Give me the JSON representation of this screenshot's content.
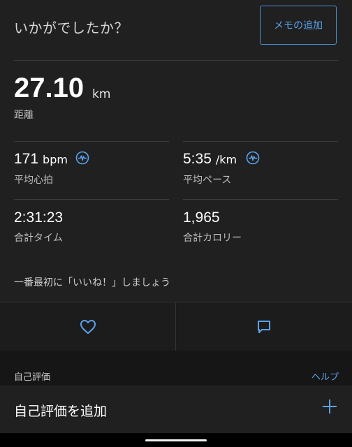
{
  "header": {
    "prompt": "いかがでしたか？",
    "memo_button": "メモの追加"
  },
  "distance": {
    "value": "27.10",
    "unit": "km",
    "label": "距離"
  },
  "stats": [
    {
      "value": "171",
      "unit": "bpm",
      "label": "平均心拍",
      "icon": "heart-rate-icon"
    },
    {
      "value": "5:35",
      "unit": "/km",
      "label": "平均ペース",
      "icon": "heart-rate-icon"
    },
    {
      "value": "2:31:23",
      "unit": "",
      "label": "合計タイム"
    },
    {
      "value": "1,965",
      "unit": "",
      "label": "合計カロリー"
    }
  ],
  "first_like": "一番最初に「いいね！」しましょう",
  "actions": {
    "like_icon": "heart-icon",
    "comment_icon": "comment-icon"
  },
  "self_evaluation": {
    "section_label": "自己評価",
    "help_link": "ヘルプ",
    "add_label": "自己評価を追加",
    "add_icon": "plus-icon"
  },
  "colors": {
    "accent": "#5aa3ee",
    "background": "#202020"
  }
}
